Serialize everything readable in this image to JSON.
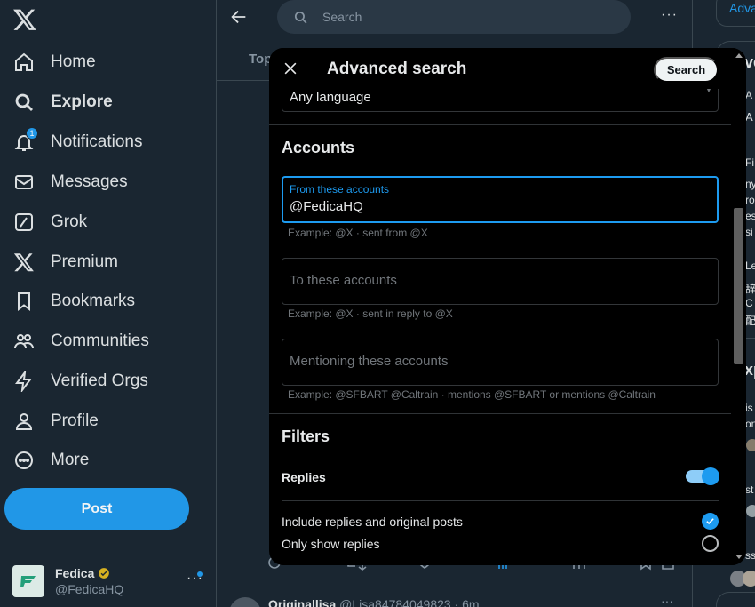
{
  "sidebar": {
    "items": [
      {
        "label": "Home",
        "icon": "home-icon"
      },
      {
        "label": "Explore",
        "icon": "search-icon"
      },
      {
        "label": "Notifications",
        "icon": "bell-icon",
        "badge": "1"
      },
      {
        "label": "Messages",
        "icon": "envelope-icon"
      },
      {
        "label": "Grok",
        "icon": "grok-icon"
      },
      {
        "label": "Premium",
        "icon": "x-logo-icon"
      },
      {
        "label": "Bookmarks",
        "icon": "bookmark-icon"
      },
      {
        "label": "Communities",
        "icon": "people-icon"
      },
      {
        "label": "Verified Orgs",
        "icon": "lightning-icon"
      },
      {
        "label": "Profile",
        "icon": "person-icon"
      },
      {
        "label": "More",
        "icon": "more-circle-icon"
      }
    ],
    "post_label": "Post",
    "account": {
      "name": "Fedica",
      "handle": "@FedicaHQ"
    }
  },
  "main": {
    "search_placeholder": "Search",
    "tab_partial": "Top",
    "tweet": {
      "author": "Originallisa",
      "handle": "@Lisa84784049823 · 6m"
    }
  },
  "right": {
    "advanced_link": "Adva",
    "fragments": [
      "ve",
      "A",
      "A",
      "Fi",
      "ny",
      "ro",
      "es",
      "si",
      "Le",
      "辞",
      "C",
      "配",
      "xp",
      "is",
      "on",
      "st",
      "ss"
    ]
  },
  "modal": {
    "title": "Advanced search",
    "search_button": "Search",
    "language_value": "Any language",
    "accounts": {
      "title": "Accounts",
      "from": {
        "label": "From these accounts",
        "value": "@FedicaHQ",
        "hint": "Example: @X · sent from @X"
      },
      "to": {
        "placeholder": "To these accounts",
        "hint": "Example: @X · sent in reply to @X"
      },
      "mentioning": {
        "placeholder": "Mentioning these accounts",
        "hint": "Example: @SFBART @Caltrain · mentions @SFBART or mentions @Caltrain"
      }
    },
    "filters": {
      "title": "Filters",
      "replies_label": "Replies",
      "replies_enabled": true,
      "options": [
        {
          "label": "Include replies and original posts",
          "selected": true
        },
        {
          "label": "Only show replies",
          "selected": false
        }
      ]
    }
  },
  "colors": {
    "accent": "#1d9bf0",
    "background": "#15202b",
    "modal_bg": "#000000",
    "muted": "#71767b"
  }
}
